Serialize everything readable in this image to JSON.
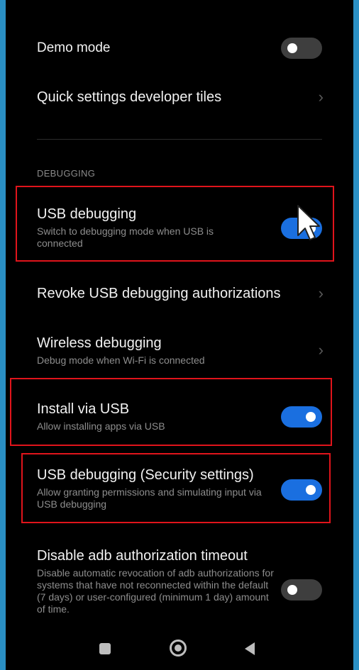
{
  "settings": {
    "demo_mode": {
      "title": "Demo mode",
      "enabled": false
    },
    "qs_tiles": {
      "title": "Quick settings developer tiles"
    },
    "section_debugging": "DEBUGGING",
    "usb_debugging": {
      "title": "USB debugging",
      "subtitle": "Switch to debugging mode when USB is connected",
      "enabled": true
    },
    "revoke": {
      "title": "Revoke USB debugging authorizations"
    },
    "wireless": {
      "title": "Wireless debugging",
      "subtitle": "Debug mode when Wi-Fi is connected"
    },
    "install_usb": {
      "title": "Install via USB",
      "subtitle": "Allow installing apps via USB",
      "enabled": true
    },
    "usb_security": {
      "title": "USB debugging (Security settings)",
      "subtitle": "Allow granting permissions and simulating input via USB debugging",
      "enabled": true
    },
    "adb_timeout": {
      "title": "Disable adb authorization timeout",
      "subtitle": "Disable automatic revocation of adb authorizations for systems that have not reconnected within the default (7 days) or user-configured (minimum 1 day) amount of time.",
      "enabled": false
    }
  },
  "colors": {
    "toggle_on": "#1a6fe0",
    "toggle_off": "#3e3e3e",
    "highlight": "#e0141b",
    "background": "#000000"
  },
  "navbar": {
    "icons": [
      "recents-icon",
      "home-icon",
      "back-icon"
    ]
  }
}
